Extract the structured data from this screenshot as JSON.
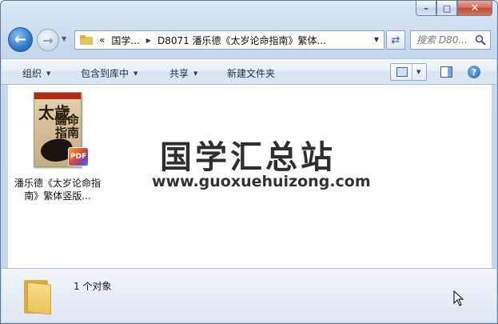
{
  "window": {
    "caption_buttons": {
      "minimize": "–",
      "maximize": "□",
      "close": "✕"
    }
  },
  "address_bar": {
    "back_glyph": "←",
    "forward_glyph": "→",
    "overflow": "«",
    "crumbs": [
      "国学...",
      "D8071 潘乐德《太岁论命指南》繁体..."
    ],
    "refresh_glyph": "⇄"
  },
  "search": {
    "placeholder": "搜索 D80...",
    "icon": "search-icon"
  },
  "command_bar": {
    "organize": "组织",
    "include_in_library": "包含到库中",
    "share": "共享",
    "new_folder": "新建文件夹",
    "help_glyph": "?"
  },
  "content": {
    "files": [
      {
        "name": "潘乐德《太岁论命指南》繁体竖版...",
        "type": "pdf",
        "badge": "PDF",
        "cover_title_large": "太歲",
        "cover_title_small": "論命指南"
      }
    ],
    "watermark_title": "国学汇总站",
    "watermark_url": "www.guoxuehuizong.com"
  },
  "details_pane": {
    "status": "1 个对象"
  },
  "colors": {
    "accent": "#2f78c8",
    "close_red": "#c14a31",
    "folder_yellow": "#ecc35b"
  }
}
